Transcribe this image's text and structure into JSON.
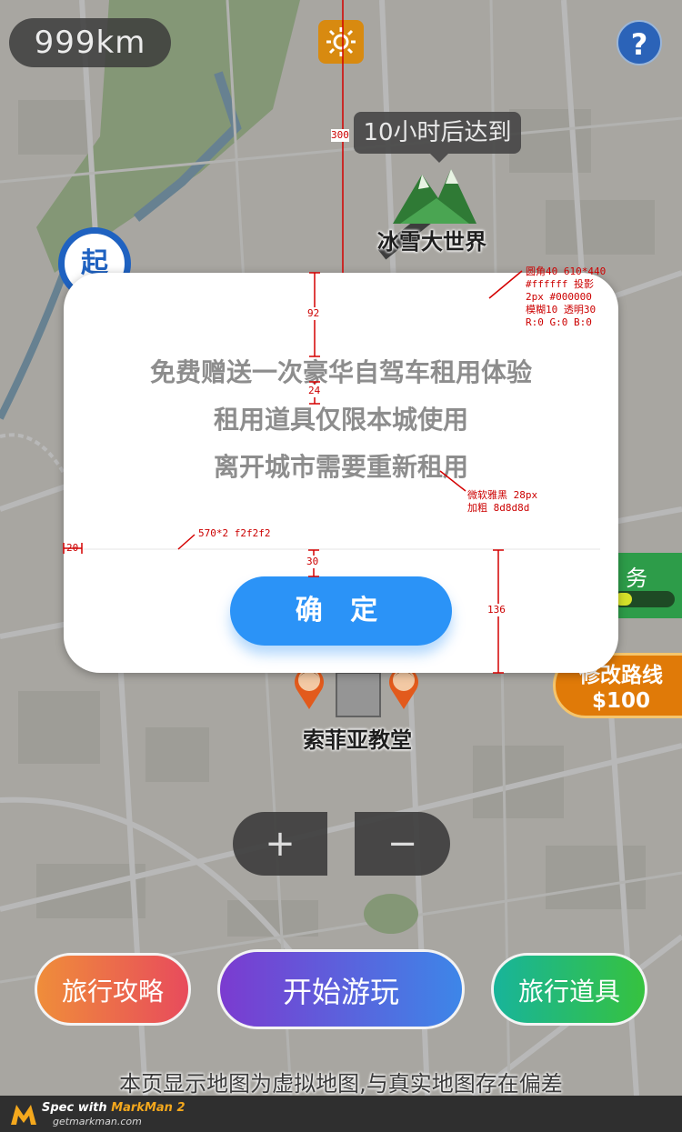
{
  "header": {
    "distance": "999km",
    "sun_icon": "sun-icon",
    "help_icon": "question-icon",
    "help_label": "?"
  },
  "map": {
    "tooltip": "10小时后达到",
    "landmark_top": "冰雪大世界",
    "start_marker": "起",
    "landmark_bottom": "索菲亚教堂",
    "task_label": "务",
    "task_progress": 0.3,
    "modify_route_label": "修改路线",
    "modify_route_price": "$100",
    "zoom_in": "+",
    "zoom_out": "−"
  },
  "modal": {
    "lines": [
      "免费赠送一次豪华自驾车租用体验",
      "租用道具仅限本城使用",
      "离开城市需要重新租用"
    ],
    "confirm_label": "确 定",
    "confirm_color": "#2b93f7",
    "text_color": "#8d8d8d",
    "divider_color": "#f2f2f2"
  },
  "bottom_bar": {
    "guide": "旅行攻略",
    "start_play": "开始游玩",
    "props": "旅行道具"
  },
  "disclaimer": "本页显示地图为虚拟地图,与真实地图存在偏差",
  "annotations": {
    "modal_spec": [
      "圆角40 610*440",
      "#ffffff 投影",
      "2px #000000",
      "模糊10 透明30",
      "R:0 G:0 B:0"
    ],
    "font_spec": [
      "微软雅黑 28px",
      "加粗 8d8d8d"
    ],
    "divider_spec": "570*2 f2f2f2",
    "dim_300": "300",
    "dim_92": "92",
    "dim_24": "24",
    "dim_20": "20",
    "dim_30": "30",
    "dim_136": "136"
  },
  "footer": {
    "title_prefix": "Spec with ",
    "title_brand": "MarkMan 2",
    "url": "getmarkman.com"
  }
}
